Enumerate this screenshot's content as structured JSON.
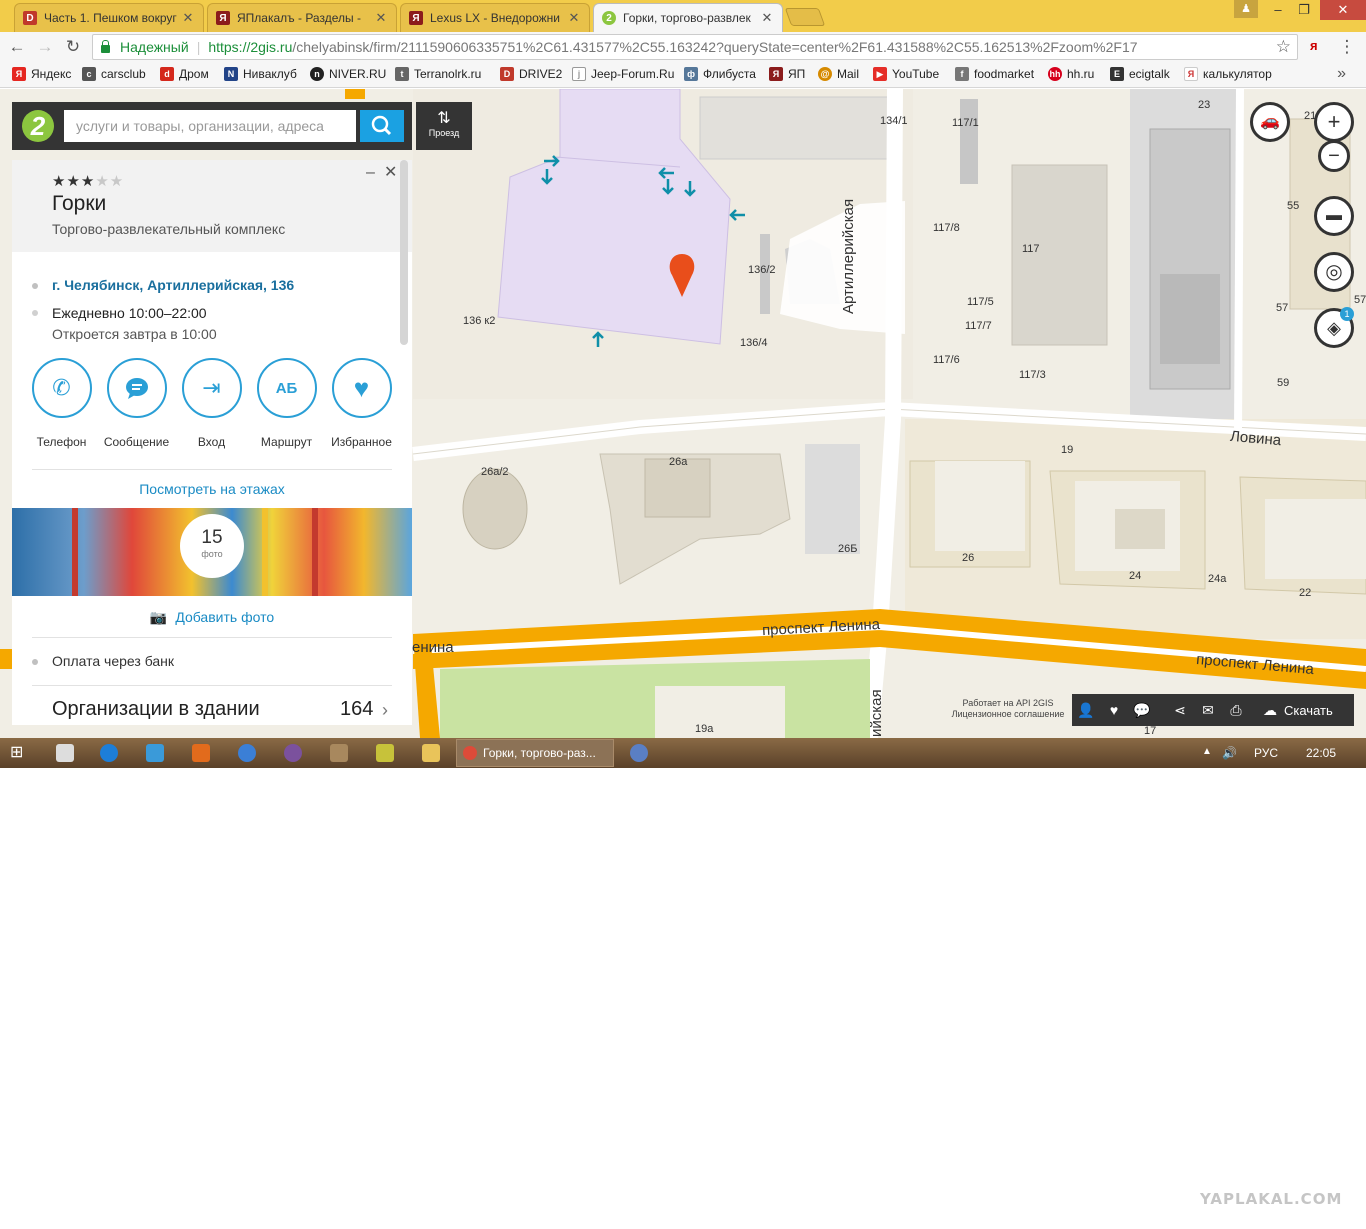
{
  "tabs": [
    {
      "title": "Часть 1. Пешком вокруг",
      "icon_letter": "D",
      "icon_color": "#c0392b"
    },
    {
      "title": "ЯПлакалъ - Разделы - ",
      "icon_letter": "Я",
      "icon_color": "#8b1c1c"
    },
    {
      "title": "Lexus LX - Внедорожни",
      "icon_letter": "Я",
      "icon_color": "#8b1c1c"
    },
    {
      "title": "Горки, торгово-развлек",
      "icon_letter": "2",
      "icon_color": "#8cc63f"
    }
  ],
  "window": {
    "minimize": "–",
    "maximize": "❐",
    "close": "✕"
  },
  "address_bar": {
    "secure_label": "Надежный",
    "host": "https://2gis.ru",
    "path": "/chelyabinsk/firm/2111590606335751%2C61.431577%2C55.163242?queryState=center%2F61.431588%2C55.162513%2Fzoom%2F17"
  },
  "bookmarks": [
    {
      "label": "Яндекс",
      "icon": "Я",
      "color": "#e52620"
    },
    {
      "label": "carsclub",
      "icon": "c",
      "color": "#555555"
    },
    {
      "label": "Дром",
      "icon": "d",
      "color": "#d4281c"
    },
    {
      "label": "Нивaклуб",
      "icon": "N",
      "color": "#224488"
    },
    {
      "label": "NIVER.RU",
      "icon": "n",
      "color": "#222222"
    },
    {
      "label": "Terranolrk.ru",
      "icon": "t",
      "color": "#666666"
    },
    {
      "label": "DRIVE2",
      "icon": "D",
      "color": "#c0392b"
    },
    {
      "label": "Jeep-Forum.Ru",
      "icon": "j",
      "color": "#999999"
    },
    {
      "label": "Флибуста",
      "icon": "ф",
      "color": "#557799"
    },
    {
      "label": "ЯП",
      "icon": "Я",
      "color": "#8b1c1c"
    },
    {
      "label": "Mail",
      "icon": "@",
      "color": "#d68a00"
    },
    {
      "label": "YouTube",
      "icon": "▶",
      "color": "#e52d27"
    },
    {
      "label": "foodmarket",
      "icon": "f",
      "color": "#777777"
    },
    {
      "label": "hh.ru",
      "icon": "hh",
      "color": "#d6001c"
    },
    {
      "label": "ecigtalk",
      "icon": "E",
      "color": "#333333"
    },
    {
      "label": "калькулятор",
      "icon": "Я",
      "color": "#cc3333"
    }
  ],
  "search": {
    "placeholder": "услуги и товары, организации, адреса",
    "route_label": "Проезд"
  },
  "card": {
    "stars_on": "★★★",
    "stars_off": "★★",
    "rating": 3,
    "title": "Горки",
    "subtitle": "Торгово-развлекательный комплекс",
    "address": "г. Челябинск, Артиллерийская, 136",
    "hours": "Ежедневно 10:00–22:00",
    "opens": "Откроется завтра в 10:00",
    "actions": [
      {
        "label": "Телефон",
        "icon": "phone-icon"
      },
      {
        "label": "Сообщение",
        "icon": "message-icon"
      },
      {
        "label": "Вход",
        "icon": "entrance-icon"
      },
      {
        "label": "Маршрут",
        "icon": "route-icon"
      },
      {
        "label": "Избранное",
        "icon": "heart-icon"
      }
    ],
    "floors_link": "Посмотреть на этажах",
    "photo_count": "15",
    "photo_word": "фото",
    "add_photo": "Добавить фото",
    "payment": "Оплата через банк",
    "orgs_label": "Организации в здании",
    "orgs_count": "164"
  },
  "map_labels": {
    "buildings": [
      "134/1",
      "117/1",
      "23",
      "21",
      "55",
      "117/8",
      "117",
      "136/2",
      "117/5",
      "117/7",
      "57",
      "57",
      "136 к2",
      "136/4",
      "117/6",
      "117/3",
      "59",
      "26а/2",
      "26а",
      "19",
      "26Б",
      "26",
      "24",
      "24а",
      "22",
      "19а",
      "17"
    ],
    "streets": [
      "Артиллерийская",
      "Ловина",
      "проспект Ленина",
      "проспект Ленина",
      "енина",
      "ийская"
    ]
  },
  "map_controls": {
    "zoom_in": "+",
    "zoom_out": "−",
    "layers_badge": "1"
  },
  "bottom_bar": {
    "download": "Скачать"
  },
  "credits": {
    "line1": "Работает на API 2GIS",
    "line2": "Лицензионное соглашение"
  },
  "taskbar": {
    "active_window": "Горки, торгово-раз...",
    "language": "РУС",
    "time": "22:05"
  },
  "watermark": "YAPLAKAL.COM"
}
